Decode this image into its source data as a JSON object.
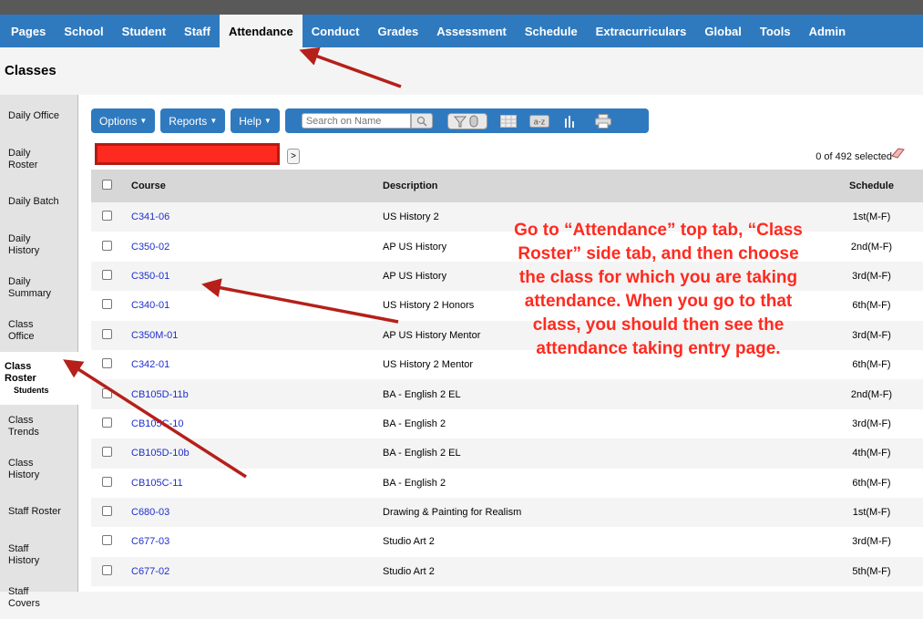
{
  "nav": {
    "tabs": [
      {
        "label": "Pages"
      },
      {
        "label": "School"
      },
      {
        "label": "Student"
      },
      {
        "label": "Staff"
      },
      {
        "label": "Attendance",
        "active": true
      },
      {
        "label": "Conduct"
      },
      {
        "label": "Grades"
      },
      {
        "label": "Assessment"
      },
      {
        "label": "Schedule"
      },
      {
        "label": "Extracurriculars"
      },
      {
        "label": "Global"
      },
      {
        "label": "Tools"
      },
      {
        "label": "Admin"
      }
    ]
  },
  "page_title": "Classes",
  "sidebar": {
    "items": [
      {
        "label": "Daily Office"
      },
      {
        "label": "Daily Roster"
      },
      {
        "label": "Daily Batch"
      },
      {
        "label": "Daily History"
      },
      {
        "label": "Daily Summary"
      },
      {
        "label": "Class Office"
      },
      {
        "label": "Class Roster",
        "sub": "Students",
        "active": true
      },
      {
        "label": "Class Trends"
      },
      {
        "label": "Class History"
      },
      {
        "label": "Staff Roster"
      },
      {
        "label": "Staff History"
      },
      {
        "label": "Staff Covers"
      }
    ]
  },
  "toolbar": {
    "options_label": "Options",
    "reports_label": "Reports",
    "help_label": "Help",
    "search_placeholder": "Search on Name",
    "icons": [
      "search-icon",
      "filter-icon",
      "grid-icon",
      "sort-az-icon",
      "chart-icon",
      "print-icon"
    ]
  },
  "selection": {
    "next_label": ">",
    "count_text": "0 of 492 selected"
  },
  "table": {
    "headers": {
      "course": "Course",
      "description": "Description",
      "schedule": "Schedule"
    },
    "rows": [
      {
        "course": "C341-06",
        "description": "US History 2",
        "schedule": "1st(M-F)"
      },
      {
        "course": "C350-02",
        "description": "AP US History",
        "schedule": "2nd(M-F)"
      },
      {
        "course": "C350-01",
        "description": "AP US History",
        "schedule": "3rd(M-F)"
      },
      {
        "course": "C340-01",
        "description": "US History 2 Honors",
        "schedule": "6th(M-F)"
      },
      {
        "course": "C350M-01",
        "description": "AP US History Mentor",
        "schedule": "3rd(M-F)"
      },
      {
        "course": "C342-01",
        "description": "US History 2 Mentor",
        "schedule": "6th(M-F)"
      },
      {
        "course": "CB105D-11b",
        "description": "BA - English 2 EL",
        "schedule": "2nd(M-F)"
      },
      {
        "course": "CB105C-10",
        "description": "BA - English 2",
        "schedule": "3rd(M-F)"
      },
      {
        "course": "CB105D-10b",
        "description": "BA - English 2 EL",
        "schedule": "4th(M-F)"
      },
      {
        "course": "CB105C-11",
        "description": "BA - English 2",
        "schedule": "6th(M-F)"
      },
      {
        "course": "C680-03",
        "description": "Drawing & Painting for Realism",
        "schedule": "1st(M-F)"
      },
      {
        "course": "C677-03",
        "description": "Studio Art 2",
        "schedule": "3rd(M-F)"
      },
      {
        "course": "C677-02",
        "description": "Studio Art 2",
        "schedule": "5th(M-F)"
      }
    ]
  },
  "annotation": {
    "text": "Go to “Attendance” top tab, “Class Roster” side tab, and then choose the class for which you are taking attendance. When you go to that class, you should then see the attendance taking entry page.",
    "color": "#ff2a1f"
  },
  "colors": {
    "nav_blue": "#2f7abf",
    "link_blue": "#1f2fcc",
    "arrow_red": "#b5201a"
  }
}
